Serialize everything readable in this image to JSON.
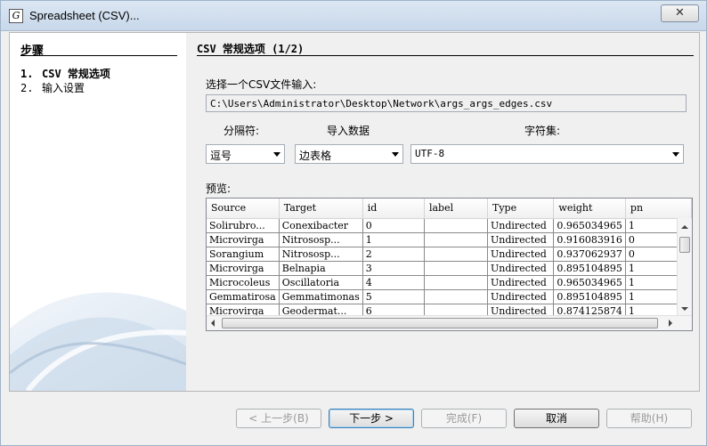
{
  "window": {
    "title": "Spreadsheet (CSV)...",
    "close_glyph": "✕",
    "icon_glyph": "G"
  },
  "steps": {
    "title": "步骤",
    "items": [
      {
        "num": "1.",
        "label": "CSV 常规选项",
        "active": true
      },
      {
        "num": "2.",
        "label": "输入设置",
        "active": false
      }
    ]
  },
  "main": {
    "title": "CSV 常规选项 (1/2)",
    "file_label": "选择一个CSV文件输入:",
    "file_path": "C:\\Users\\Administrator\\Desktop\\Network\\args_args_edges.csv",
    "separator_label": "分隔符:",
    "separator_value": "逗号",
    "import_label": "导入数据",
    "import_value": "边表格",
    "charset_label": "字符集:",
    "charset_value": "UTF-8",
    "preview_label": "预览:"
  },
  "preview": {
    "columns": [
      "Source",
      "Target",
      "id",
      "label",
      "Type",
      "weight",
      "pn"
    ],
    "rows": [
      [
        "Solirubro...",
        "Conexibacter",
        "0",
        "",
        "Undirected",
        "0.965034965",
        "1"
      ],
      [
        "Microvirga",
        "Nitrososp...",
        "1",
        "",
        "Undirected",
        "0.916083916",
        "0"
      ],
      [
        "Sorangium",
        "Nitrososp...",
        "2",
        "",
        "Undirected",
        "0.937062937",
        "0"
      ],
      [
        "Microvirga",
        "Belnapia",
        "3",
        "",
        "Undirected",
        "0.895104895",
        "1"
      ],
      [
        "Microcoleus",
        "Oscillatoria",
        "4",
        "",
        "Undirected",
        "0.965034965",
        "1"
      ],
      [
        "Gemmatirosa",
        "Gemmatimonas",
        "5",
        "",
        "Undirected",
        "0.895104895",
        "1"
      ],
      [
        "Microvirga",
        "Geodermat...",
        "6",
        "",
        "Undirected",
        "0.874125874",
        "1"
      ]
    ]
  },
  "buttons": {
    "back": "< 上一步(B)",
    "next": "下一步 >",
    "finish": "完成(F)",
    "cancel": "取消",
    "help": "帮助(H)"
  }
}
